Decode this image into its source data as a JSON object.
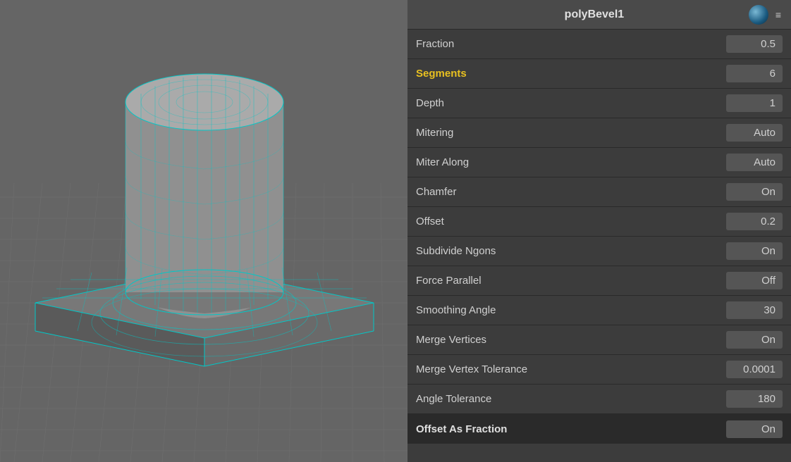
{
  "header": {
    "title": "polyBevel1",
    "ball_icon": "ball-icon",
    "menu_icon": "≡"
  },
  "rows": [
    {
      "id": "fraction",
      "label": "Fraction",
      "value": "0.5",
      "highlighted": false,
      "last": false
    },
    {
      "id": "segments",
      "label": "Segments",
      "value": "6",
      "highlighted": true,
      "last": false
    },
    {
      "id": "depth",
      "label": "Depth",
      "value": "1",
      "highlighted": false,
      "last": false
    },
    {
      "id": "mitering",
      "label": "Mitering",
      "value": "Auto",
      "highlighted": false,
      "last": false
    },
    {
      "id": "miter-along",
      "label": "Miter Along",
      "value": "Auto",
      "highlighted": false,
      "last": false
    },
    {
      "id": "chamfer",
      "label": "Chamfer",
      "value": "On",
      "highlighted": false,
      "last": false
    },
    {
      "id": "offset",
      "label": "Offset",
      "value": "0.2",
      "highlighted": false,
      "last": false
    },
    {
      "id": "subdivide-ngons",
      "label": "Subdivide Ngons",
      "value": "On",
      "highlighted": false,
      "last": false
    },
    {
      "id": "force-parallel",
      "label": "Force Parallel",
      "value": "Off",
      "highlighted": false,
      "last": false
    },
    {
      "id": "smoothing-angle",
      "label": "Smoothing Angle",
      "value": "30",
      "highlighted": false,
      "last": false
    },
    {
      "id": "merge-vertices",
      "label": "Merge Vertices",
      "value": "On",
      "highlighted": false,
      "last": false
    },
    {
      "id": "merge-vertex-tolerance",
      "label": "Merge Vertex Tolerance",
      "value": "0.0001",
      "highlighted": false,
      "last": false
    },
    {
      "id": "angle-tolerance",
      "label": "Angle Tolerance",
      "value": "180",
      "highlighted": false,
      "last": false
    },
    {
      "id": "offset-as-fraction",
      "label": "Offset As Fraction",
      "value": "On",
      "highlighted": false,
      "last": true
    }
  ]
}
